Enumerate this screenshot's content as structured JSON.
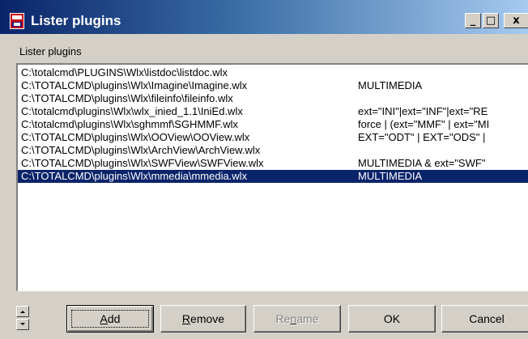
{
  "window": {
    "title": "Lister plugins",
    "controls": {
      "minimize": "_",
      "maximize": "□",
      "close": "x"
    }
  },
  "group_label": "Lister plugins",
  "plugins": [
    {
      "path": "C:\\totalcmd\\PLUGINS\\Wlx\\listdoc\\listdoc.wlx",
      "detect": ""
    },
    {
      "path": "C:\\TOTALCMD\\plugins\\Wlx\\Imagine\\Imagine.wlx",
      "detect": "MULTIMEDIA"
    },
    {
      "path": "C:\\TOTALCMD\\plugins\\Wlx\\fileinfo\\fileinfo.wlx",
      "detect": ""
    },
    {
      "path": "C:\\totalcmd\\plugins\\Wlx\\wlx_inied_1.1\\IniEd.wlx",
      "detect": "ext=\"INI\"|ext=\"INF\"|ext=\"RE"
    },
    {
      "path": "C:\\totalcmd\\plugins\\Wlx\\sghmmf\\SGHMMF.wlx",
      "detect": "force | (ext=\"MMF\" | ext=\"MI"
    },
    {
      "path": "C:\\TOTALCMD\\plugins\\Wlx\\OOView\\OOView.wlx",
      "detect": "EXT=\"ODT\" | EXT=\"ODS\" |"
    },
    {
      "path": "C:\\TOTALCMD\\plugins\\Wlx\\ArchView\\ArchView.wlx",
      "detect": ""
    },
    {
      "path": "C:\\TOTALCMD\\plugins\\Wlx\\SWFView\\SWFView.wlx",
      "detect": "MULTIMEDIA & ext=\"SWF\""
    },
    {
      "path": "C:\\TOTALCMD\\plugins\\Wlx\\mmedia\\mmedia.wlx",
      "detect": "MULTIMEDIA",
      "selected": true
    }
  ],
  "buttons": {
    "add": {
      "pre": "",
      "accel": "A",
      "post": "dd"
    },
    "remove": {
      "pre": "",
      "accel": "R",
      "post": "emove"
    },
    "rename": {
      "pre": "Re",
      "accel": "n",
      "post": "ame"
    },
    "ok": "OK",
    "cancel": "Cancel"
  },
  "colors": {
    "selection": "#0a246a",
    "title_start": "#0a246a",
    "title_end": "#a6caf0",
    "face": "#d4d0c8"
  }
}
